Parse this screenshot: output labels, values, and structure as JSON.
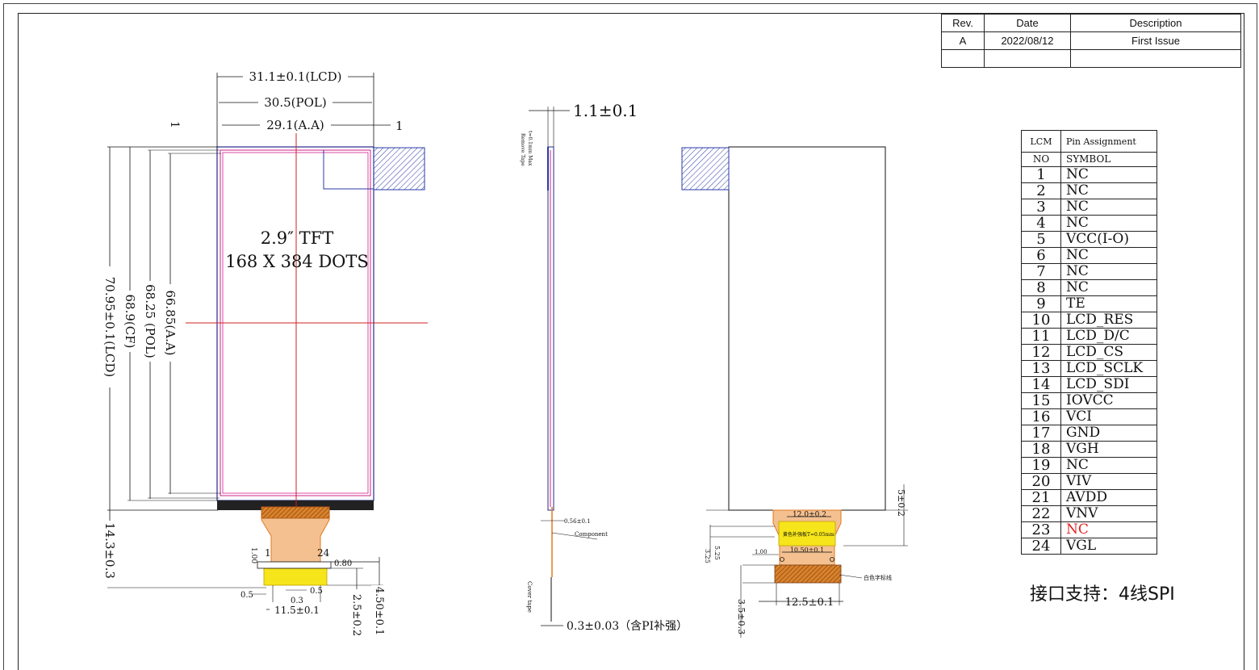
{
  "revision_table": {
    "headers": [
      "Rev.",
      "Date",
      "Description"
    ],
    "rows": [
      [
        "A",
        "2022/08/12",
        "First Issue"
      ],
      [
        "",
        "",
        ""
      ]
    ]
  },
  "front_view": {
    "title_line1": "2.9″ TFT",
    "title_line2": "168 X 384 DOTS",
    "dim_lcd_width": "31.1±0.1(LCD)",
    "dim_pol_width": "30.5(POL)",
    "dim_aa_width": "29.1(A.A)",
    "dim_left_1": "1",
    "dim_right_1": "1",
    "dim_lcd_height": "70.95±0.1(LCD)",
    "dim_cf_height": "68.9(CF)",
    "dim_pol_height": "68.25 (POL)",
    "dim_aa_height": "66.85(A.A)",
    "dim_fpc_len": "14.3±0.3",
    "dim_fpc_width": "11.5±0.1",
    "dim_pitch_05a": "0.5",
    "dim_pitch_03": "0.3",
    "dim_pitch_05b": "0.5",
    "dim_stiff": "2.5±0.2",
    "dim_tail": "4.50±0.1",
    "dim_080": "0.80",
    "dim_100": "1.00",
    "pin_first": "1",
    "pin_last": "24"
  },
  "side_view": {
    "dim_thickness": "1.1±0.1",
    "dim_fpc_thick": "0.3±0.03（含PI补强）",
    "note_tape": "Remove Tape",
    "note_tape2": "t=0.1mm Max",
    "note_056": "0.56±0.1",
    "note_component": "Component",
    "note_cover": "Cover tape"
  },
  "back_view": {
    "dim_120": "12.0±0.2",
    "dim_1050": "10.50±0.1",
    "dim_125": "12.5±0.1",
    "dim_5": "5±0.2",
    "dim_325": "3.25",
    "dim_525": "5.25",
    "dim_35": "3.5±0.3",
    "dim_100": "1.00",
    "note_yellow": "黄色补强板T=0.05mm",
    "note_white": "白色字标线"
  },
  "pin_table": {
    "title_left": "LCM",
    "title_right": "Pin Assignment",
    "col_no": "NO",
    "col_symbol": "SYMBOL",
    "rows": [
      {
        "no": "1",
        "symbol": "NC"
      },
      {
        "no": "2",
        "symbol": "NC"
      },
      {
        "no": "3",
        "symbol": "NC"
      },
      {
        "no": "4",
        "symbol": "NC"
      },
      {
        "no": "5",
        "symbol": "VCC(I-O)"
      },
      {
        "no": "6",
        "symbol": "NC"
      },
      {
        "no": "7",
        "symbol": "NC"
      },
      {
        "no": "8",
        "symbol": "NC"
      },
      {
        "no": "9",
        "symbol": "TE"
      },
      {
        "no": "10",
        "symbol": "LCD_RES"
      },
      {
        "no": "11",
        "symbol": "LCD_D/C"
      },
      {
        "no": "12",
        "symbol": "LCD_CS"
      },
      {
        "no": "13",
        "symbol": "LCD_SCLK"
      },
      {
        "no": "14",
        "symbol": "LCD_SDI"
      },
      {
        "no": "15",
        "symbol": "IOVCC"
      },
      {
        "no": "16",
        "symbol": "VCI"
      },
      {
        "no": "17",
        "symbol": "GND"
      },
      {
        "no": "18",
        "symbol": "VGH"
      },
      {
        "no": "19",
        "symbol": "NC"
      },
      {
        "no": "20",
        "symbol": "VIV"
      },
      {
        "no": "21",
        "symbol": "AVDD"
      },
      {
        "no": "22",
        "symbol": "VNV"
      },
      {
        "no": "23",
        "symbol": "NC",
        "highlight": "#e22222"
      },
      {
        "no": "24",
        "symbol": "VGL"
      }
    ]
  },
  "interface_note": "接口支持：4线SPI"
}
